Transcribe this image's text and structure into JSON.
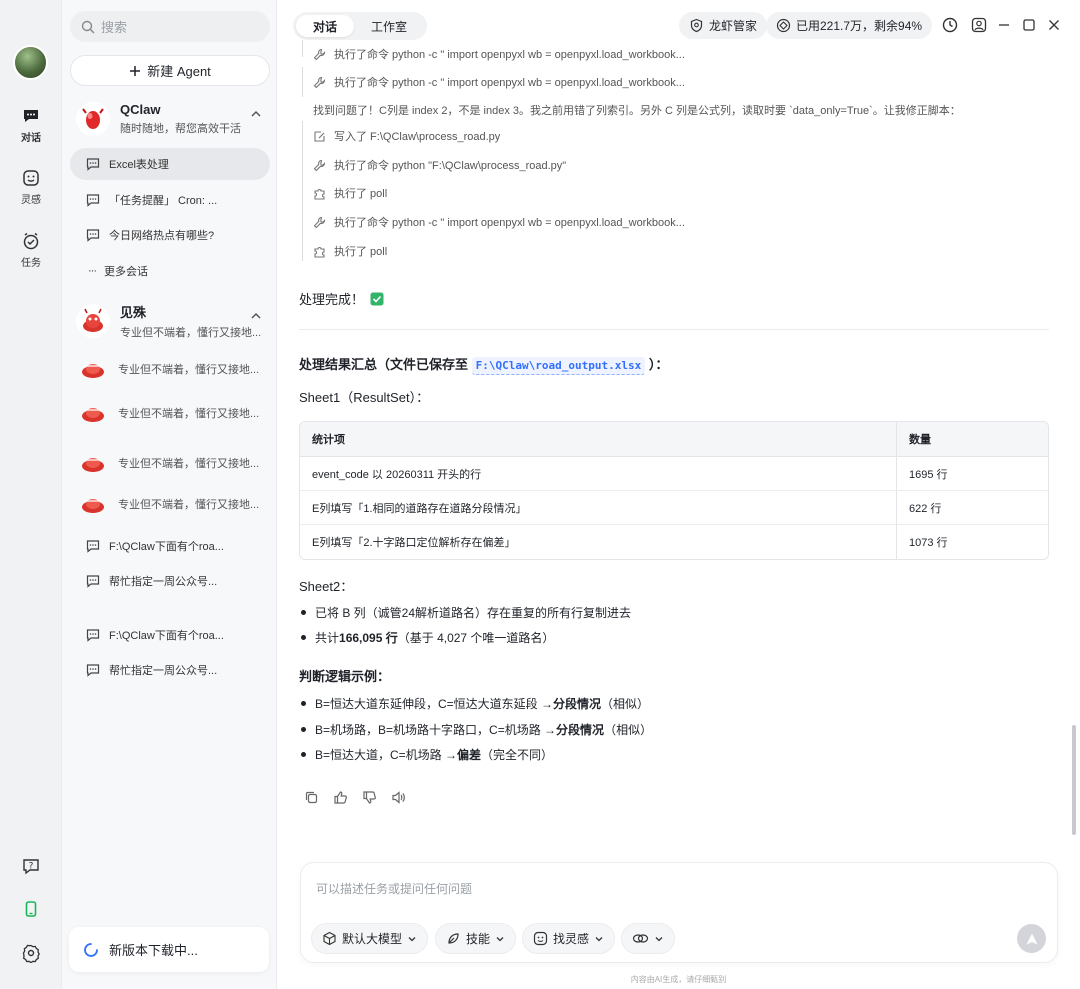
{
  "sidebar": {
    "search_placeholder": "搜索",
    "new_agent": "新建 Agent",
    "agent1": {
      "name": "QClaw",
      "desc": "随时随地，帮您高效干活"
    },
    "sessions": [
      "Excel表处理",
      "「任务提醒」 Cron: ...",
      "今日网络热点有哪些?"
    ],
    "more": "更多会话",
    "agent2": {
      "name": "见殊",
      "desc": "专业但不端着，懂行又接地..."
    },
    "agent2_rows": [
      "专业但不端着，懂行又接地...",
      "专业但不端着，懂行又接地...",
      "专业但不端着，懂行又接地...",
      "专业但不端着，懂行又接地..."
    ],
    "extra_sessions": [
      "F:\\QClaw下面有个roa...",
      "帮忙指定一周公众号...",
      "F:\\QClaw下面有个roa...",
      "帮忙指定一周公众号..."
    ],
    "update": "新版本下载中..."
  },
  "rail": {
    "chat": "对话",
    "inspire": "灵感",
    "tasks": "任务"
  },
  "topbar": {
    "tabs": [
      "对话",
      "工作室"
    ],
    "manager": "龙虾管家",
    "quota": "已用221.7万，剩余94%"
  },
  "steps": [
    "执行了命令 python -c \" import openpyxl wb = openpyxl.load_workbook...",
    "执行了命令 python -c \" import openpyxl wb = openpyxl.load_workbook...",
    "写入了 F:\\QClaw\\process_road.py",
    "执行了命令 python \"F:\\QClaw\\process_road.py\"",
    "执行了 poll",
    "执行了命令 python -c \" import openpyxl wb = openpyxl.load_workbook...",
    "执行了 poll"
  ],
  "note": "找到问题了！C列是 index 2，不是 index 3。我之前用错了列索引。另外 C 列是公式列，读取时要 `data_only=True`。让我修正脚本：",
  "done": "处理完成！",
  "summary": {
    "prefix": "处理结果汇总（文件已保存至",
    "path": "F:\\QClaw\\road_output.xlsx",
    "suffix": "）："
  },
  "sheet1": "Sheet1（ResultSet）：",
  "table": {
    "headers": [
      "统计项",
      "数量"
    ],
    "rows": [
      [
        "event_code 以 20260311 开头的行",
        "1695 行"
      ],
      [
        "E列填写「1.相同的道路存在道路分段情况」",
        "622 行"
      ],
      [
        "E列填写「2.十字路口定位解析存在偏差」",
        "1073 行"
      ]
    ]
  },
  "sheet2": "Sheet2：",
  "sheet2_items": [
    {
      "text": "已将 B 列（诚管24解析道路名）存在重复的所有行复制进去"
    },
    {
      "pre": "共计 ",
      "bold": "166,095 行",
      "post": "（基于 4,027 个唯一道路名）"
    }
  ],
  "logic_title": "判断逻辑示例：",
  "logic_items": [
    {
      "pre": "B=恒达大道东延伸段，C=恒达大道东延段 → ",
      "bold": "分段情况",
      "post": "（相似）"
    },
    {
      "pre": "B=机场路，B=机场路十字路口，C=机场路 → ",
      "bold": "分段情况",
      "post": "（相似）"
    },
    {
      "pre": "B=恒达大道，C=机场路 → ",
      "bold": "偏差",
      "post": "（完全不同）"
    }
  ],
  "composer": {
    "placeholder": "可以描述任务或提问任何问题",
    "model": "默认大模型",
    "skills": "技能",
    "inspire": "找灵感"
  },
  "footer": "内容由AI生成，请仔细甄别"
}
